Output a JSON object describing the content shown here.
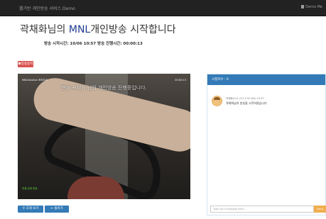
{
  "header": {
    "brand": "웹기반 개인방송 서비스 Demo",
    "right_label": "Demo Me"
  },
  "page": {
    "title_prefix": "곽채화님의 ",
    "title_mnl": "MNL",
    "title_suffix": "개인방송 시작합니다",
    "subtitle": "방송 시작시간: 10/06 10:57  방송 진행시간: 00:00:13"
  },
  "toolbar": {
    "stop_label": "방송중지"
  },
  "video": {
    "overlay_label": "MNLSolution 조리도요",
    "overlay_time": "00:00:13",
    "banner": "현재 곽채화 님의 개인방송 진행중입니다.",
    "status_text": "연결 상태 양호"
  },
  "buttons": {
    "big_view": "크게 보기",
    "go_back": "돌아가"
  },
  "chat": {
    "header": "시청자수 : 0",
    "message_meta": "곽채화(211.111.174.162)  10:57",
    "message_text": "곽채화님의 방송을 시작하였습니다",
    "input_placeholder": "Type your message here...",
    "send_label": "Send"
  },
  "colors": {
    "navbar": "#222222",
    "primary": "#337ab7",
    "danger": "#d9534f",
    "warning": "#f0ad4e",
    "title_accent": "#1f3d8c"
  }
}
